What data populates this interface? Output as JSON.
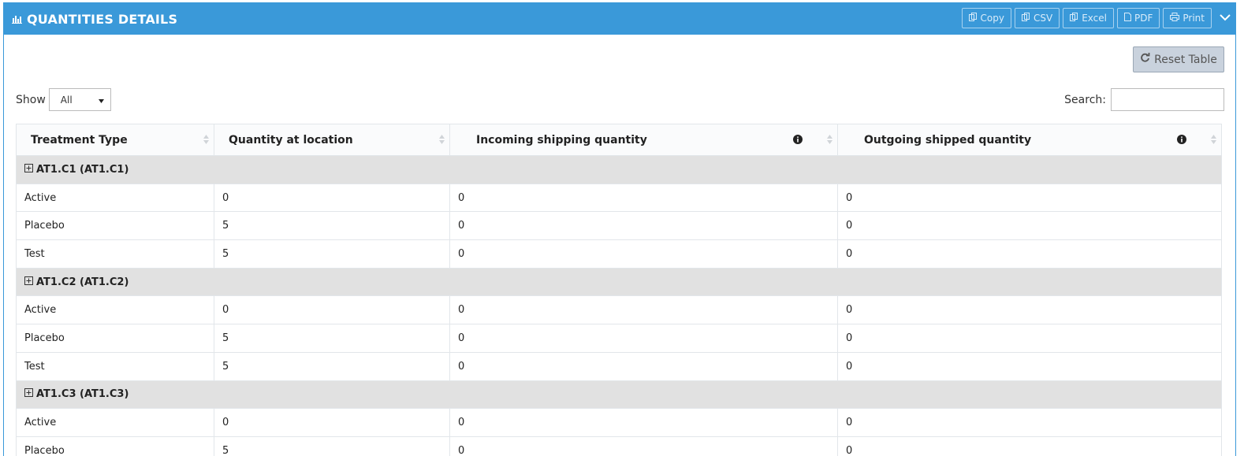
{
  "panel": {
    "title": "QUANTITIES DETAILS",
    "export_buttons": [
      "Copy",
      "CSV",
      "Excel",
      "PDF",
      "Print"
    ]
  },
  "controls": {
    "reset_label": "Reset Table",
    "show_label": "Show",
    "show_value": "All",
    "search_label": "Search:"
  },
  "table": {
    "columns": [
      "Treatment Type",
      "Quantity at location",
      "Incoming shipping quantity",
      "Outgoing shipped quantity"
    ],
    "groups": [
      {
        "label": "AT1.C1 (AT1.C1)",
        "rows": [
          [
            "Active",
            "0",
            "0",
            "0"
          ],
          [
            "Placebo",
            "5",
            "0",
            "0"
          ],
          [
            "Test",
            "5",
            "0",
            "0"
          ]
        ]
      },
      {
        "label": "AT1.C2 (AT1.C2)",
        "rows": [
          [
            "Active",
            "0",
            "0",
            "0"
          ],
          [
            "Placebo",
            "5",
            "0",
            "0"
          ],
          [
            "Test",
            "5",
            "0",
            "0"
          ]
        ]
      },
      {
        "label": "AT1.C3 (AT1.C3)",
        "rows": [
          [
            "Active",
            "0",
            "0",
            "0"
          ],
          [
            "Placebo",
            "5",
            "0",
            "0"
          ]
        ]
      }
    ]
  },
  "colors": {
    "header_bg": "#3a99d9",
    "group_row_bg": "#e1e1e1",
    "reset_bg": "#c9d2dd"
  }
}
